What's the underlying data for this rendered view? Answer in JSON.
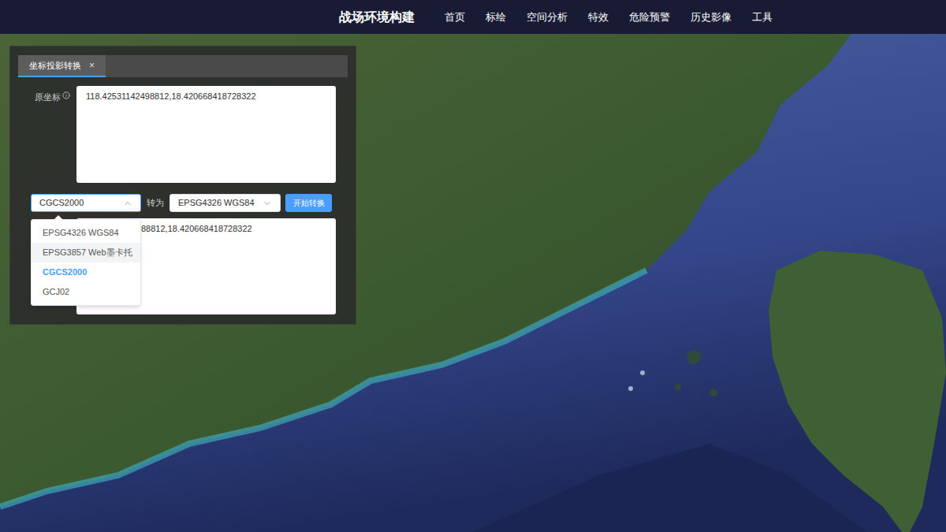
{
  "header": {
    "title": "战场环境构建",
    "nav": [
      {
        "label": "首页",
        "selected": false
      },
      {
        "label": "标绘",
        "selected": false
      },
      {
        "label": "空间分析",
        "selected": false
      },
      {
        "label": "特效",
        "selected": false
      },
      {
        "label": "危险预警",
        "selected": false
      },
      {
        "label": "历史影像",
        "selected": false
      },
      {
        "label": "工具",
        "selected": false
      }
    ]
  },
  "panel": {
    "tabs": [
      {
        "label": "坐标投影转换",
        "close": "×",
        "selected": true
      }
    ],
    "source_label": "原坐标",
    "source_value": "118.42531142498812,18.420668418728322",
    "from_select": {
      "value": "CGCS2000",
      "open": true,
      "options": [
        {
          "label": "EPSG4326 WGS84",
          "selected": false,
          "hovered": false
        },
        {
          "label": "EPSG3857 Web墨卡托",
          "selected": false,
          "hovered": true
        },
        {
          "label": "CGCS2000",
          "selected": true,
          "hovered": false
        },
        {
          "label": "GCJ02",
          "selected": false,
          "hovered": false
        }
      ]
    },
    "to_label": "转为",
    "to_select": {
      "value": "EPSG4326 WGS84",
      "open": false
    },
    "convert_button": "开始转换",
    "result_value": "88812,18.420668418728322"
  }
}
